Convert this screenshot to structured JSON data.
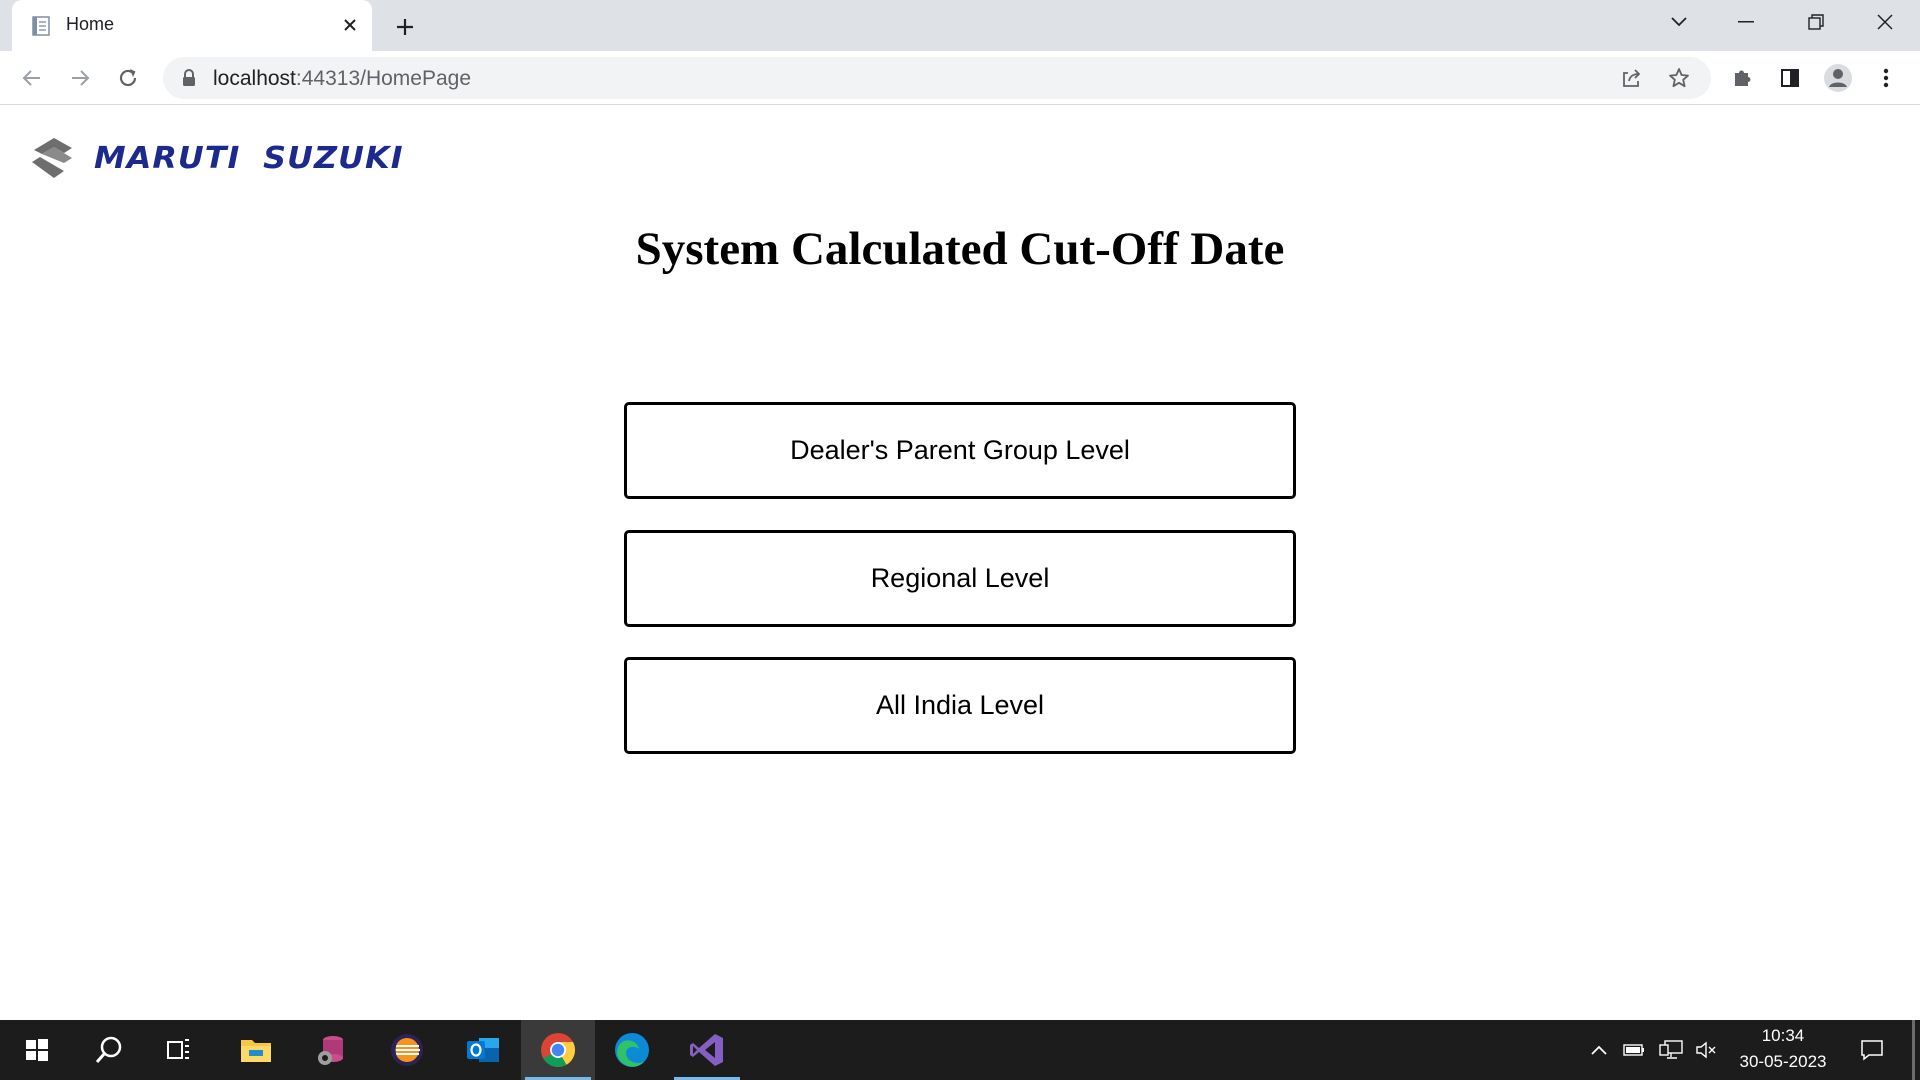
{
  "browser": {
    "tab_title": "Home",
    "url_host": "localhost",
    "url_rest": ":44313/HomePage"
  },
  "page": {
    "brand_name": "MARUTI SUZUKI",
    "brand_color": "#1b2a8c",
    "title": "System Calculated Cut-Off Date",
    "buttons": [
      {
        "label": "Dealer's Parent Group Level"
      },
      {
        "label": "Regional Level"
      },
      {
        "label": "All India Level"
      }
    ]
  },
  "taskbar": {
    "apps": [
      "windows-start-icon",
      "search-icon",
      "task-view-icon",
      "file-explorer-icon",
      "database-tool-icon",
      "eclipse-icon",
      "outlook-icon",
      "chrome-icon",
      "edge-icon",
      "visual-studio-icon"
    ],
    "active_app": "chrome-icon",
    "time": "10:34",
    "date": "30-05-2023"
  }
}
